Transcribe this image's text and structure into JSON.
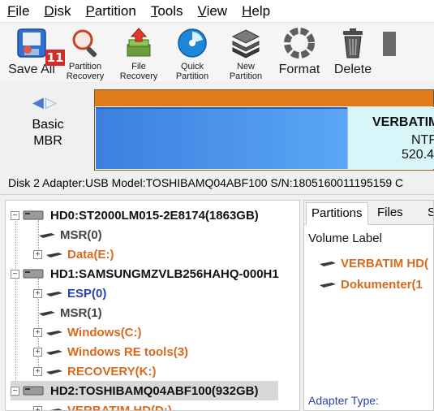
{
  "menu": [
    {
      "label": "File",
      "accel": "F",
      "rest": "ile"
    },
    {
      "label": "Disk",
      "accel": "D",
      "rest": "isk"
    },
    {
      "label": "Partition",
      "accel": "P",
      "rest": "artition"
    },
    {
      "label": "Tools",
      "accel": "T",
      "rest": "ools"
    },
    {
      "label": "View",
      "accel": "V",
      "rest": "iew"
    },
    {
      "label": "Help",
      "accel": "H",
      "rest": "elp"
    }
  ],
  "toolbar": {
    "save_all": "Save All",
    "badge": "11",
    "partition_recovery_1": "Partition",
    "partition_recovery_2": "Recovery",
    "file_recovery_1": "File",
    "file_recovery_2": "Recovery",
    "quick_partition_1": "Quick",
    "quick_partition_2": "Partition",
    "new_partition_1": "New",
    "new_partition_2": "Partition",
    "format": "Format",
    "delete": "Delete"
  },
  "diskmap": {
    "basic": "Basic",
    "mbr": "MBR",
    "partition_name": "VERBATIM",
    "partition_fs": "NTF",
    "partition_size": "520.4",
    "colors": {
      "header_bar": "#e07b1a",
      "used": "#3c7fe0",
      "free": "#d8f6fa"
    }
  },
  "info_line": "Disk 2 Adapter:USB  Model:TOSHIBAMQ04ABF100  S/N:1805160011195159  C",
  "tree": {
    "hd0": "HD0:ST2000LM015-2E8174(1863GB)",
    "hd0_msr": "MSR(0)",
    "hd0_data": "Data(E:)",
    "hd1": "HD1:SAMSUNGMZVLB256HAHQ-000H1",
    "hd1_esp": "ESP(0)",
    "hd1_msr": "MSR(1)",
    "hd1_windows": "Windows(C:)",
    "hd1_winre": "Windows RE tools(3)",
    "hd1_recovery": "RECOVERY(K:)",
    "hd2": "HD2:TOSHIBAMQ04ABF100(932GB)",
    "hd2_verbatim": "VERBATIM HD(D:)"
  },
  "right_panel": {
    "tab_partitions": "Partitions",
    "tab_files": "Files",
    "tab_more": "S",
    "volume_label_header": "Volume Label",
    "row1": "VERBATIM HD(",
    "row2": "Dokumenter(1",
    "adapter_type": "Adapter Type:"
  }
}
